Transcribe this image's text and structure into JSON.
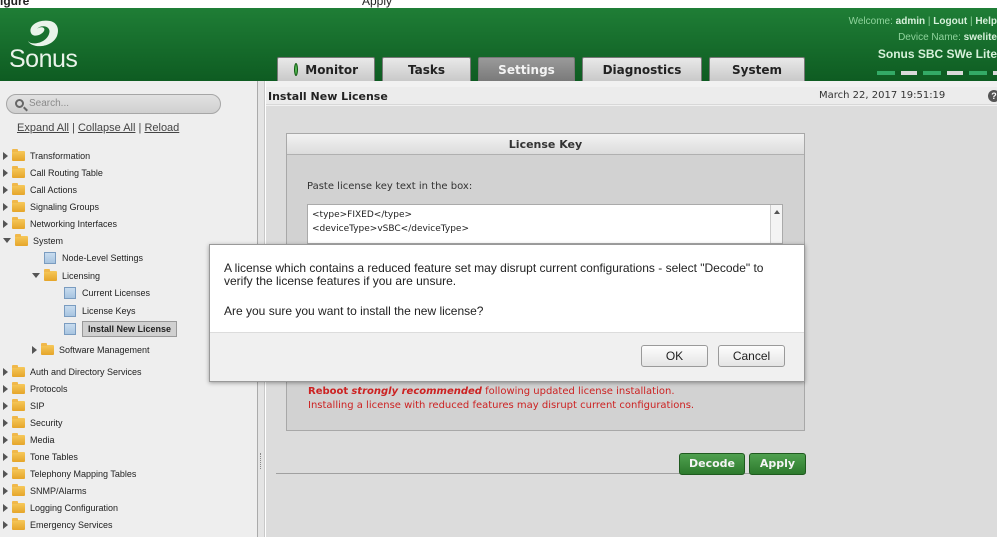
{
  "caption": {
    "left": "igure",
    "right": "Apply"
  },
  "header": {
    "logo_text": "Sonus",
    "welcome_prefix": "Welcome: ",
    "welcome_user": "admin",
    "logout": "Logout",
    "help": "Help",
    "device_label": "Device Name: ",
    "device_name": "swelite",
    "product": "Sonus SBC SWe Lite"
  },
  "tabs": [
    {
      "label": "Monitor"
    },
    {
      "label": "Tasks"
    },
    {
      "label": "Settings"
    },
    {
      "label": "Diagnostics"
    },
    {
      "label": "System"
    }
  ],
  "sidebar": {
    "search_placeholder": "Search...",
    "expand_all": "Expand All",
    "collapse_all": "Collapse All",
    "reload": "Reload",
    "sep": "|",
    "items": [
      {
        "label": "Transformation"
      },
      {
        "label": "Call Routing Table"
      },
      {
        "label": "Call Actions"
      },
      {
        "label": "Signaling Groups"
      },
      {
        "label": "Networking Interfaces"
      },
      {
        "label": "System"
      },
      {
        "label": "Node-Level Settings"
      },
      {
        "label": "Licensing"
      },
      {
        "label": "Current Licenses"
      },
      {
        "label": "License Keys"
      },
      {
        "label": "Install New License"
      },
      {
        "label": "Software Management"
      },
      {
        "label": "Auth and Directory Services"
      },
      {
        "label": "Protocols"
      },
      {
        "label": "SIP"
      },
      {
        "label": "Security"
      },
      {
        "label": "Media"
      },
      {
        "label": "Tone Tables"
      },
      {
        "label": "Telephony Mapping Tables"
      },
      {
        "label": "SNMP/Alarms"
      },
      {
        "label": "Logging Configuration"
      },
      {
        "label": "Emergency Services"
      }
    ]
  },
  "main": {
    "title": "Install New License",
    "date": "March 22, 2017 19:51:19",
    "help_glyph": "?",
    "license_box": {
      "heading": "License Key",
      "instruction": "Paste license key text in the box:",
      "text_line1": "<type>FIXED</type>",
      "text_line2": "<deviceType>vSBC</deviceType>",
      "warn_reboot": "Reboot",
      "warn_strongly": "strongly recommended",
      "warn_rest": " following updated license installation.",
      "warn2": "Installing a license with reduced features may disrupt current configurations."
    },
    "decode_label": "Decode",
    "apply_label": "Apply"
  },
  "dialog": {
    "message": "A license which contains a reduced feature set may disrupt current configurations - select \"Decode\" to verify the license features if you are unsure.",
    "question": "Are you sure you want to install the new license?",
    "ok_label": "OK",
    "cancel_label": "Cancel"
  },
  "colors": {
    "header_green": "#1f7e36",
    "button_green": "#2d7a2d",
    "warning_red": "#cc2222"
  }
}
